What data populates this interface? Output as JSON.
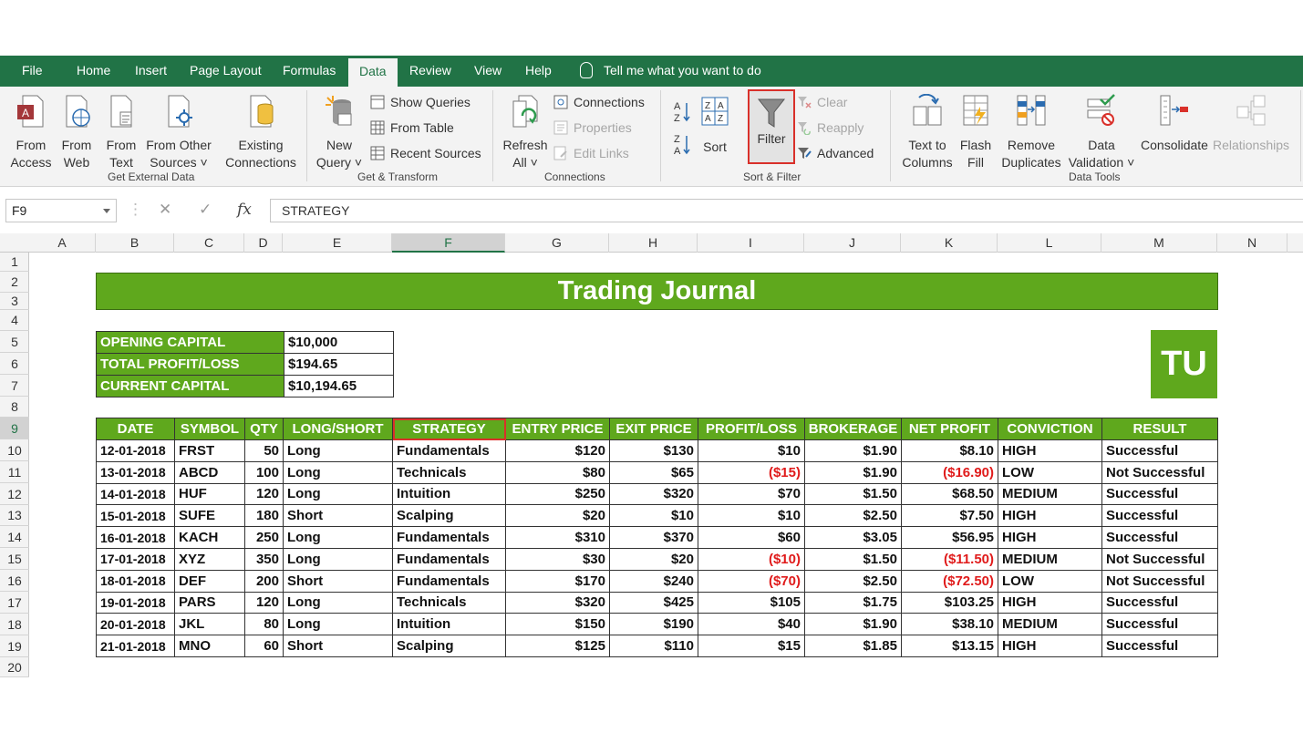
{
  "tabs": [
    "File",
    "Home",
    "Insert",
    "Page Layout",
    "Formulas",
    "Data",
    "Review",
    "View",
    "Help"
  ],
  "active_tab": "Data",
  "tell_me": "Tell me what you want to do",
  "ribbon": {
    "get_external": {
      "from_access": [
        "From",
        "Access"
      ],
      "from_web": [
        "From",
        "Web"
      ],
      "from_text": [
        "From",
        "Text"
      ],
      "from_other": [
        "From Other",
        "Sources ˅"
      ],
      "existing": [
        "Existing",
        "Connections"
      ],
      "label": "Get External Data"
    },
    "transform": {
      "new_query": [
        "New",
        "Query ˅"
      ],
      "show_queries": "Show Queries",
      "from_table": "From Table",
      "recent_sources": "Recent Sources",
      "label": "Get & Transform"
    },
    "connections": {
      "refresh": [
        "Refresh",
        "All ˅"
      ],
      "connections": "Connections",
      "properties": "Properties",
      "edit_links": "Edit Links",
      "label": "Connections"
    },
    "sort_filter": {
      "sort": "Sort",
      "filter": "Filter",
      "clear": "Clear",
      "reapply": "Reapply",
      "advanced": "Advanced",
      "label": "Sort & Filter"
    },
    "data_tools": {
      "text_to_columns": [
        "Text to",
        "Columns"
      ],
      "flash_fill": [
        "Flash",
        "Fill"
      ],
      "remove_duplicates": [
        "Remove",
        "Duplicates"
      ],
      "data_validation": [
        "Data",
        "Validation ˅"
      ],
      "consolidate": "Consolidate",
      "relationships": "Relationships",
      "label": "Data Tools"
    }
  },
  "formula_bar": {
    "name_box": "F9",
    "content": "STRATEGY"
  },
  "columns": [
    "A",
    "B",
    "C",
    "D",
    "E",
    "F",
    "G",
    "H",
    "I",
    "J",
    "K",
    "L",
    "M",
    "N"
  ],
  "selected_column": "F",
  "rows": [
    "1",
    "2",
    "3",
    "4",
    "5",
    "6",
    "7",
    "8",
    "9",
    "10",
    "11",
    "12",
    "13",
    "14",
    "15",
    "16",
    "17",
    "18",
    "19",
    "20"
  ],
  "selected_row": "9",
  "sheet": {
    "title": "Trading Journal",
    "logo": "TU",
    "summary": [
      {
        "key": "OPENING CAPITAL",
        "value": "$10,000"
      },
      {
        "key": "TOTAL PROFIT/LOSS",
        "value": "$194.65"
      },
      {
        "key": "CURRENT CAPITAL",
        "value": "$10,194.65"
      }
    ],
    "headers": [
      "DATE",
      "SYMBOL",
      "QTY",
      "LONG/SHORT",
      "STRATEGY",
      "ENTRY PRICE",
      "EXIT PRICE",
      "PROFIT/LOSS",
      "BROKERAGE",
      "NET PROFIT",
      "CONVICTION",
      "RESULT"
    ],
    "trades": [
      [
        "12-01-2018",
        "FRST",
        "50",
        "Long",
        "Fundamentals",
        "$120",
        "$130",
        "$10",
        "$1.90",
        "$8.10",
        "HIGH",
        "Successful"
      ],
      [
        "13-01-2018",
        "ABCD",
        "100",
        "Long",
        "Technicals",
        "$80",
        "$65",
        "($15)",
        "$1.90",
        "($16.90)",
        "LOW",
        "Not Successful"
      ],
      [
        "14-01-2018",
        "HUF",
        "120",
        "Long",
        "Intuition",
        "$250",
        "$320",
        "$70",
        "$1.50",
        "$68.50",
        "MEDIUM",
        "Successful"
      ],
      [
        "15-01-2018",
        "SUFE",
        "180",
        "Short",
        "Scalping",
        "$20",
        "$10",
        "$10",
        "$2.50",
        "$7.50",
        "HIGH",
        "Successful"
      ],
      [
        "16-01-2018",
        "KACH",
        "250",
        "Long",
        "Fundamentals",
        "$310",
        "$370",
        "$60",
        "$3.05",
        "$56.95",
        "HIGH",
        "Successful"
      ],
      [
        "17-01-2018",
        "XYZ",
        "350",
        "Long",
        "Fundamentals",
        "$30",
        "$20",
        "($10)",
        "$1.50",
        "($11.50)",
        "MEDIUM",
        "Not Successful"
      ],
      [
        "18-01-2018",
        "DEF",
        "200",
        "Short",
        "Fundamentals",
        "$170",
        "$240",
        "($70)",
        "$2.50",
        "($72.50)",
        "LOW",
        "Not Successful"
      ],
      [
        "19-01-2018",
        "PARS",
        "120",
        "Long",
        "Technicals",
        "$320",
        "$425",
        "$105",
        "$1.75",
        "$103.25",
        "HIGH",
        "Successful"
      ],
      [
        "20-01-2018",
        "JKL",
        "80",
        "Long",
        "Intuition",
        "$150",
        "$190",
        "$40",
        "$1.90",
        "$38.10",
        "MEDIUM",
        "Successful"
      ],
      [
        "21-01-2018",
        "MNO",
        "60",
        "Short",
        "Scalping",
        "$125",
        "$110",
        "$15",
        "$1.85",
        "$13.15",
        "HIGH",
        "Successful"
      ]
    ]
  },
  "colors": {
    "excel_green": "#217346",
    "sheet_green": "#5fa81d",
    "negative": "#e01b1b",
    "highlight": "#d9302a"
  }
}
